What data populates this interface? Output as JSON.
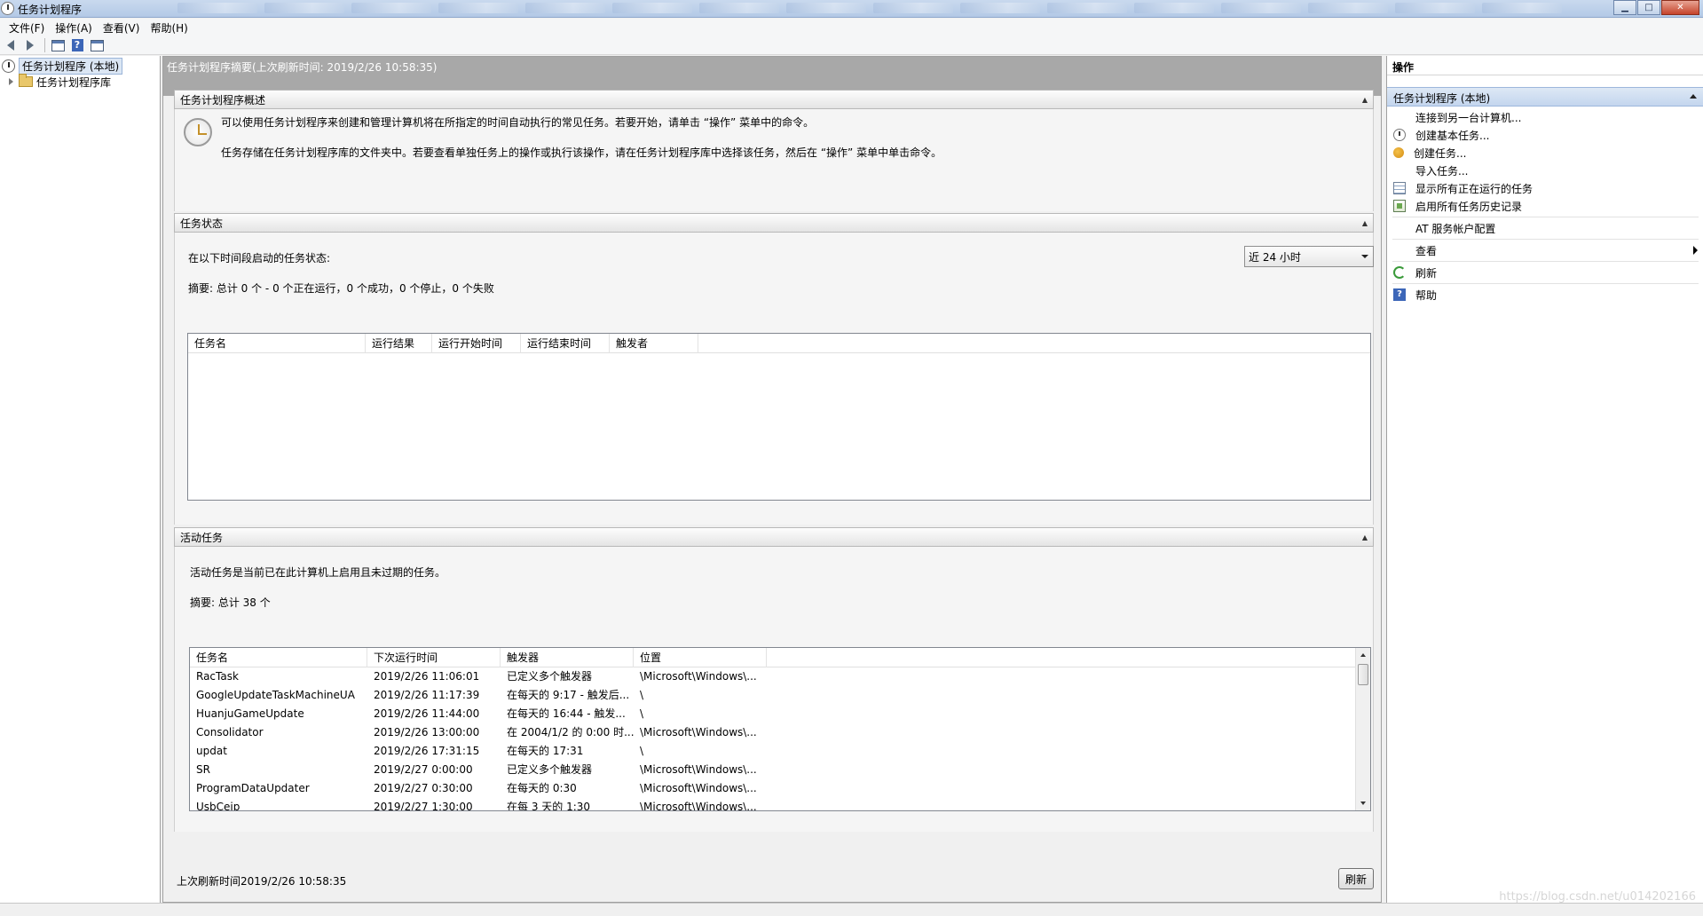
{
  "window": {
    "title": "任务计划程序"
  },
  "menubar": [
    "文件(F)",
    "操作(A)",
    "查看(V)",
    "帮助(H)"
  ],
  "tree": {
    "root": "任务计划程序 (本地)",
    "child": "任务计划程序库"
  },
  "center": {
    "header": "任务计划程序摘要(上次刷新时间: 2019/2/26 10:58:35)",
    "overview": {
      "title": "任务计划程序概述",
      "line1": "可以使用任务计划程序来创建和管理计算机将在所指定的时间自动执行的常见任务。若要开始，请单击 “操作” 菜单中的命令。",
      "line2": "任务存储在任务计划程序库的文件夹中。若要查看单独任务上的操作或执行该操作，请在任务计划程序库中选择该任务，然后在 “操作” 菜单中单击命令。"
    },
    "status": {
      "title": "任务状态",
      "period_label": "在以下时间段启动的任务状态:",
      "period_value": "近 24 小时",
      "summary": "摘要: 总计 0 个 - 0 个正在运行，0 个成功，0 个停止，0 个失败",
      "columns": [
        "任务名",
        "运行结果",
        "运行开始时间",
        "运行结束时间",
        "触发者"
      ]
    },
    "active": {
      "title": "活动任务",
      "description": "活动任务是当前已在此计算机上启用且未过期的任务。",
      "summary": "摘要: 总计 38 个",
      "columns": [
        "任务名",
        "下次运行时间",
        "触发器",
        "位置"
      ],
      "rows": [
        [
          "RacTask",
          "2019/2/26 11:06:01",
          "已定义多个触发器",
          "\\Microsoft\\Windows\\..."
        ],
        [
          "GoogleUpdateTaskMachineUA",
          "2019/2/26 11:17:39",
          "在每天的 9:17 - 触发后...",
          "\\"
        ],
        [
          "HuanjuGameUpdate",
          "2019/2/26 11:44:00",
          "在每天的 16:44 - 触发...",
          "\\"
        ],
        [
          "Consolidator",
          "2019/2/26 13:00:00",
          "在 2004/1/2 的 0:00 时...",
          "\\Microsoft\\Windows\\..."
        ],
        [
          "updat",
          "2019/2/26 17:31:15",
          "在每天的 17:31",
          "\\"
        ],
        [
          "SR",
          "2019/2/27 0:00:00",
          "已定义多个触发器",
          "\\Microsoft\\Windows\\..."
        ],
        [
          "ProgramDataUpdater",
          "2019/2/27 0:30:00",
          "在每天的 0:30",
          "\\Microsoft\\Windows\\..."
        ],
        [
          "UsbCeip",
          "2019/2/27 1:30:00",
          "在每 3 天的 1:30",
          "\\Microsoft\\Windows\\..."
        ]
      ]
    },
    "footer": {
      "last_refresh": "上次刷新时间2019/2/26 10:58:35",
      "refresh_button": "刷新"
    }
  },
  "actions": {
    "title": "操作",
    "group": "任务计划程序 (本地)",
    "items": [
      {
        "label": "连接到另一台计算机...",
        "icon": "blank"
      },
      {
        "label": "创建基本任务...",
        "icon": "clock"
      },
      {
        "label": "创建任务...",
        "icon": "task"
      },
      {
        "label": "导入任务...",
        "icon": "blank"
      },
      {
        "label": "显示所有正在运行的任务",
        "icon": "list"
      },
      {
        "label": "启用所有任务历史记录",
        "icon": "history"
      },
      {
        "label": "AT 服务帐户配置",
        "icon": "blank"
      },
      {
        "label": "查看",
        "icon": "blank"
      },
      {
        "label": "刷新",
        "icon": "refresh"
      },
      {
        "label": "帮助",
        "icon": "help"
      }
    ]
  },
  "watermark": "https://blog.csdn.net/u014202166"
}
